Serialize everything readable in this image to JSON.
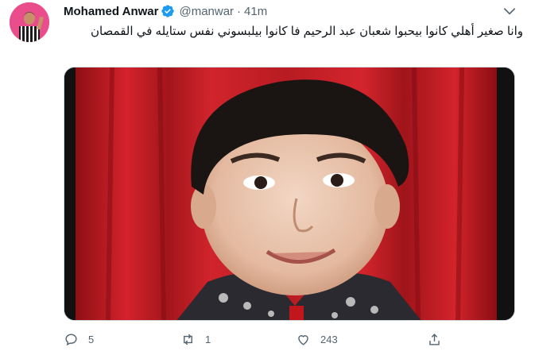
{
  "tweet": {
    "author_name": "Mohamed Anwar",
    "handle": "@manwar",
    "separator": "·",
    "time": "41m",
    "text": "وانا صغير أهلي كانوا بيحبوا شعبان عبد الرحيم فا كانوا بيلبسوني نفس ستايله في القمصان",
    "replies": "5",
    "retweets": "1",
    "likes": "243"
  },
  "colors": {
    "verified": "#1d9bf0",
    "muted": "#536471",
    "avatar_bg": "#e94d8c",
    "curtain": "#c41a22"
  },
  "icons": [
    "verified-badge-icon",
    "more-caret-icon",
    "reply-icon",
    "retweet-icon",
    "like-icon",
    "share-icon"
  ]
}
